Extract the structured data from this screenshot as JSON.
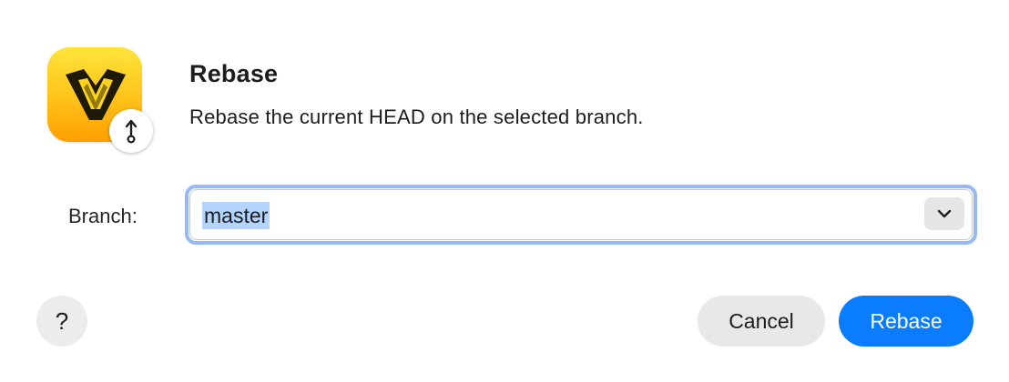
{
  "dialog": {
    "title": "Rebase",
    "message": "Rebase the current HEAD on the selected branch.",
    "app_icon": "app-logo-icon",
    "badge_icon": "rebase-arrow-icon"
  },
  "form": {
    "branch_label": "Branch:",
    "branch_value": "master",
    "dropdown_icon": "chevron-down-icon"
  },
  "buttons": {
    "help_label": "?",
    "cancel_label": "Cancel",
    "rebase_label": "Rebase"
  },
  "colors": {
    "accent": "#0a7cff",
    "focus_ring": "#96b8f4",
    "selection": "#b3d4fd",
    "icon_yellow": "#ffc21a"
  }
}
